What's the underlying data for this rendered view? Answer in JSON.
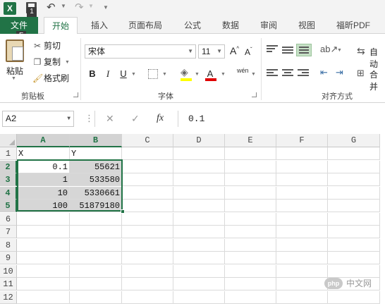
{
  "app": {
    "logo_text": "X",
    "keytips": [
      "1",
      "F"
    ]
  },
  "ribbon": {
    "tabs": [
      {
        "label": "文件",
        "active": false,
        "file": true
      },
      {
        "label": "开始",
        "active": true
      },
      {
        "label": "插入"
      },
      {
        "label": "页面布局"
      },
      {
        "label": "公式"
      },
      {
        "label": "数据"
      },
      {
        "label": "审阅"
      },
      {
        "label": "视图"
      },
      {
        "label": "福昕PDF"
      }
    ],
    "clipboard": {
      "paste_label": "粘贴",
      "cut_label": "剪切",
      "copy_label": "复制",
      "format_painter_label": "格式刷",
      "group_label": "剪贴板"
    },
    "font": {
      "font_name": "宋体",
      "font_size": "11",
      "grow_label": "A",
      "shrink_label": "A",
      "bold_label": "B",
      "italic_label": "I",
      "underline_label": "U",
      "font_color_label": "A",
      "phonetic_label": "wén",
      "group_label": "字体"
    },
    "alignment": {
      "wrap_label": "自动",
      "merge_label": "合并",
      "group_label": "对齐方式"
    }
  },
  "formula_bar": {
    "name_box": "A2",
    "cancel_icon": "✕",
    "enter_icon": "✓",
    "fx_label": "fx",
    "content": "0.1"
  },
  "sheet": {
    "columns": [
      "A",
      "B",
      "C",
      "D",
      "E",
      "F",
      "G"
    ],
    "selected_columns": [
      "A",
      "B"
    ],
    "rows": [
      "1",
      "2",
      "3",
      "4",
      "5",
      "6",
      "7",
      "8",
      "9",
      "10",
      "11",
      "12"
    ],
    "selected_rows": [
      "2",
      "3",
      "4",
      "5"
    ],
    "cells": {
      "A1": "X",
      "B1": "Y",
      "A2": "0.1",
      "B2": "55621",
      "A3": "1",
      "B3": "533580",
      "A4": "10",
      "B4": "5330661",
      "A5": "100",
      "B5": "51879180"
    },
    "active_cell": "A2",
    "accent_color": "#217346"
  },
  "watermark": {
    "logo_text": "php",
    "text": "中文网"
  }
}
